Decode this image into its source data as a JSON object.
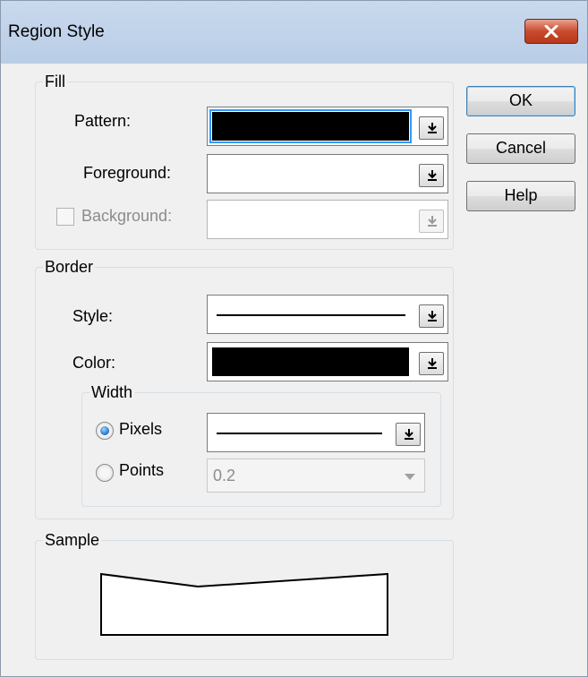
{
  "window": {
    "title": "Region Style"
  },
  "fill": {
    "legend": "Fill",
    "pattern_label": "Pattern:",
    "foreground_label": "Foreground:",
    "background_label": "Background:",
    "pattern_color": "#000000"
  },
  "border": {
    "legend": "Border",
    "style_label": "Style:",
    "color_label": "Color:",
    "color_value": "#000000",
    "width": {
      "legend": "Width",
      "pixels_label": "Pixels",
      "points_label": "Points",
      "points_value": "0.2"
    }
  },
  "sample": {
    "legend": "Sample"
  },
  "buttons": {
    "ok": "OK",
    "cancel": "Cancel",
    "help": "Help"
  }
}
